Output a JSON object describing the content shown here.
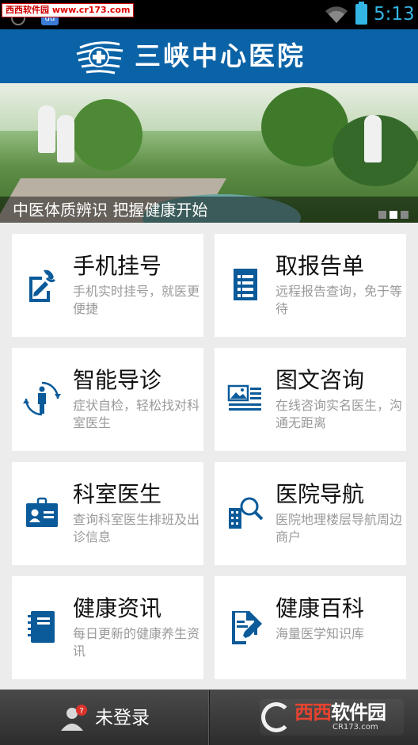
{
  "status_bar": {
    "watermark_text": "西西软件园",
    "watermark_url": "www.cr173.com",
    "baidu_icon_text": "du",
    "time": "5:13",
    "accent_color": "#33b5e5"
  },
  "header": {
    "title": "三峡中心医院",
    "bg_color": "#0b63a7"
  },
  "banner": {
    "caption": "中医体质辨识 把握健康开始",
    "slide_count": 3,
    "active_slide": 2
  },
  "menu": [
    {
      "title": "手机挂号",
      "desc": "手机实时挂号，就医更便捷",
      "icon": "phone-register-icon"
    },
    {
      "title": "取报告单",
      "desc": "远程报告查询，免于等待",
      "icon": "report-icon"
    },
    {
      "title": "智能导诊",
      "desc": "症状自检，轻松找对科室医生",
      "icon": "body-guide-icon"
    },
    {
      "title": "图文咨询",
      "desc": "在线咨询实名医生，沟通无距离",
      "icon": "image-text-icon"
    },
    {
      "title": "科室医生",
      "desc": "查询科室医生排班及出诊信息",
      "icon": "id-card-icon"
    },
    {
      "title": "医院导航",
      "desc": "医院地理楼层导航周边商户",
      "icon": "building-search-icon"
    },
    {
      "title": "健康资讯",
      "desc": "每日更新的健康养生资讯",
      "icon": "notebook-icon"
    },
    {
      "title": "健康百科",
      "desc": "海量医学知识库",
      "icon": "document-pen-icon"
    }
  ],
  "bottom_bar": {
    "login_label": "未登录",
    "badge_text": "?",
    "brand_name_1": "西西",
    "brand_name_2": "软件园",
    "brand_url": "CR173.com"
  },
  "icon_color": "#0b5a99"
}
